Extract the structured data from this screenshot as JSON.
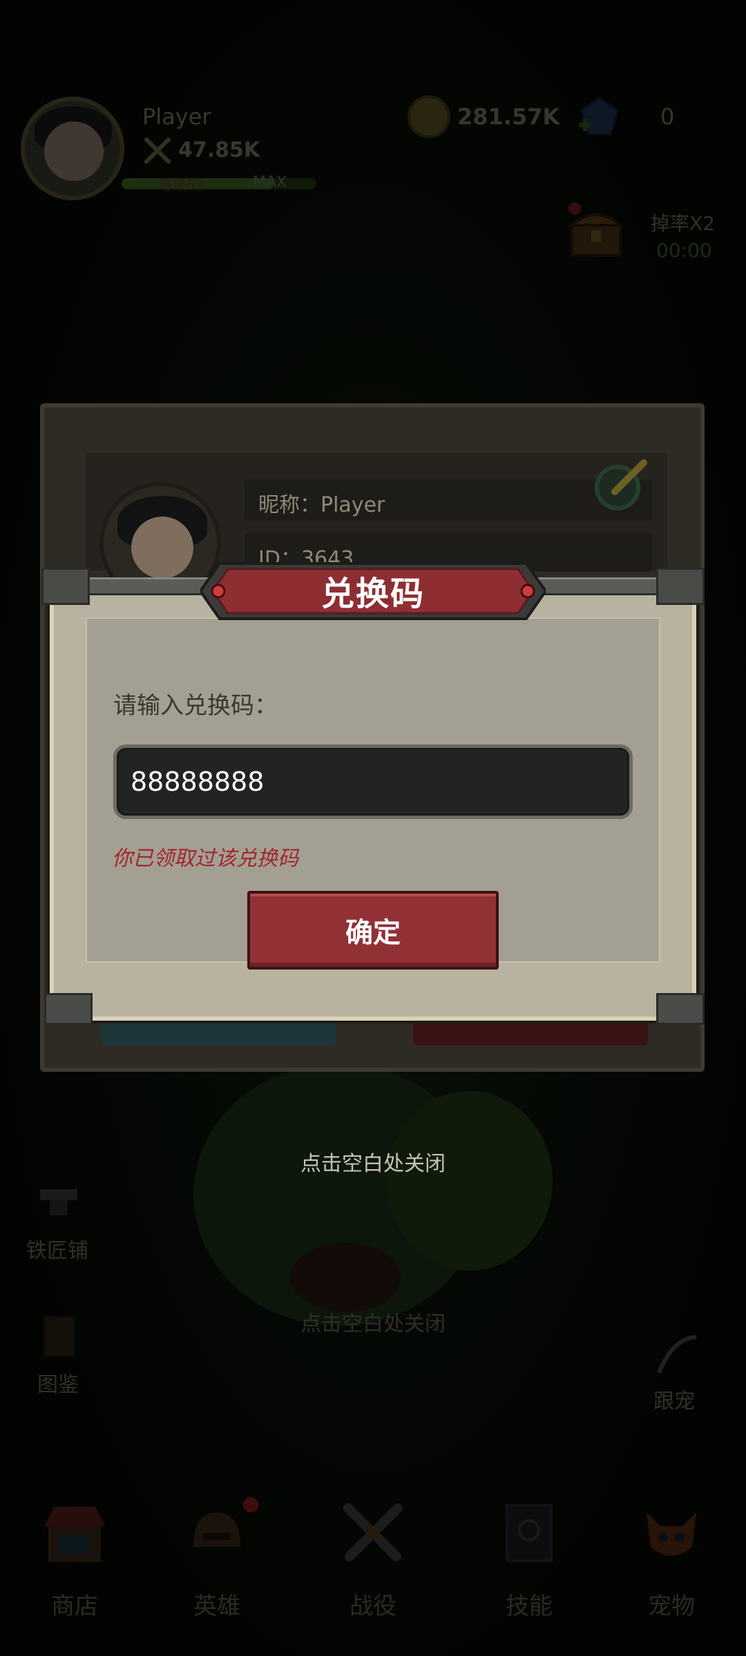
{
  "player": {
    "name": "Player",
    "power": "47.85K",
    "exp_bar_fill_fraction": 0.78,
    "exp_left_text": "等级53",
    "exp_max": "MAX"
  },
  "currency": {
    "gold": "281.57K",
    "gems": "0"
  },
  "drop_boost": {
    "label": "掉率X2",
    "timer": "00:00"
  },
  "side_menu": {
    "blacksmith": "铁匠铺",
    "codex": "图鉴",
    "follow_pet": "跟宠"
  },
  "profile_panel": {
    "nickname": "昵称：Player",
    "id": "ID：3643"
  },
  "redeem_dialog": {
    "title": "兑换码",
    "prompt": "请输入兑换码：",
    "code_value": "88888888",
    "error": "你已领取过该兑换码",
    "confirm": "确定"
  },
  "tips": {
    "close_hint": "点击空白处关闭",
    "close_hint_back": "点击空白处关闭"
  },
  "bottom_nav": [
    {
      "label": "商店",
      "icon": "shop-icon"
    },
    {
      "label": "英雄",
      "icon": "hero-helmet-icon"
    },
    {
      "label": "战役",
      "icon": "crossed-swords-icon"
    },
    {
      "label": "技能",
      "icon": "skill-book-icon"
    },
    {
      "label": "宠物",
      "icon": "pet-fox-icon"
    }
  ],
  "colors": {
    "dialog_bg": "#b8b3a1",
    "title_banner": "#8e2e33",
    "confirm_button": "#913136",
    "error_text": "#a3262b"
  }
}
